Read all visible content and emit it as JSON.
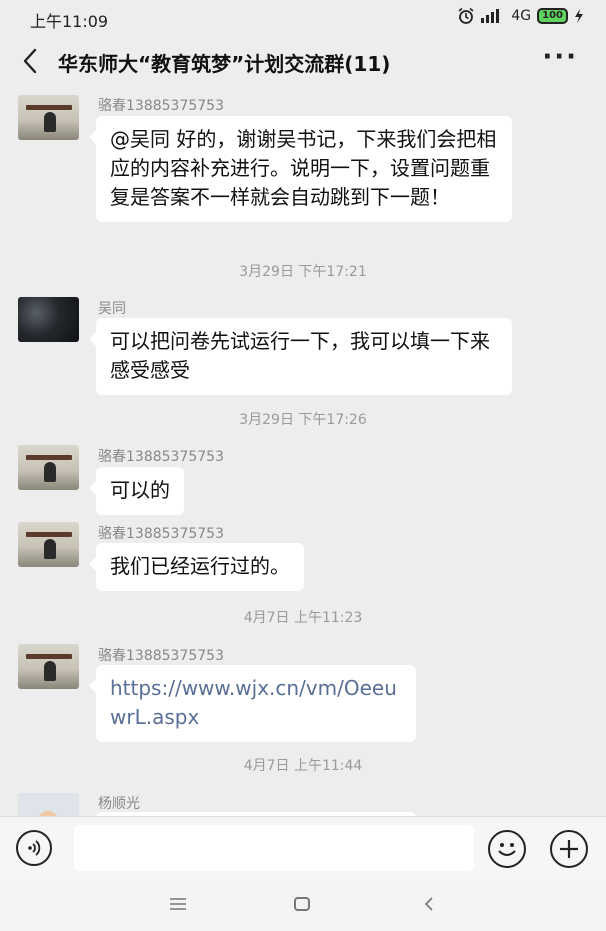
{
  "status_bar": {
    "time": "上午11:09",
    "network": "4G",
    "battery": "100"
  },
  "header": {
    "title": "华东师大“教育筑梦”计划交流群(11)"
  },
  "messages": [
    {
      "sender": "骆春13885375753",
      "text": "@吴同  好的，谢谢吴书记，下来我们会把相应的内容补充进行。说明一下，设置问题重复是答案不一样就会自动跳到下一题！"
    },
    {
      "timestamp": "3月29日 下午17:21"
    },
    {
      "sender": "吴同",
      "text": "可以把问卷先试运行一下，我可以填一下来感受感受"
    },
    {
      "timestamp": "3月29日 下午17:26"
    },
    {
      "sender": "骆春13885375753",
      "text": "可以的"
    },
    {
      "sender": "骆春13885375753",
      "text": "我们已经运行过的。"
    },
    {
      "timestamp": "4月7日 上午11:23"
    },
    {
      "sender": "骆春13885375753",
      "text": "https://www.wjx.cn/vm/OeeuwrL.aspx"
    },
    {
      "timestamp": "4月7日 上午11:44"
    },
    {
      "sender": "杨顺光",
      "text": ""
    }
  ],
  "icons": {
    "alarm": "alarm-icon",
    "signal": "signal-icon",
    "battery": "battery-icon",
    "charging": "charging-icon",
    "back": "back-arrow-icon",
    "more": "more-icon",
    "voice": "voice-icon",
    "emoji": "emoji-icon",
    "plus": "plus-icon"
  },
  "colors": {
    "background": "#ededed",
    "bubble": "#ffffff",
    "link": "#5a6f96",
    "battery": "#5fd35f"
  }
}
